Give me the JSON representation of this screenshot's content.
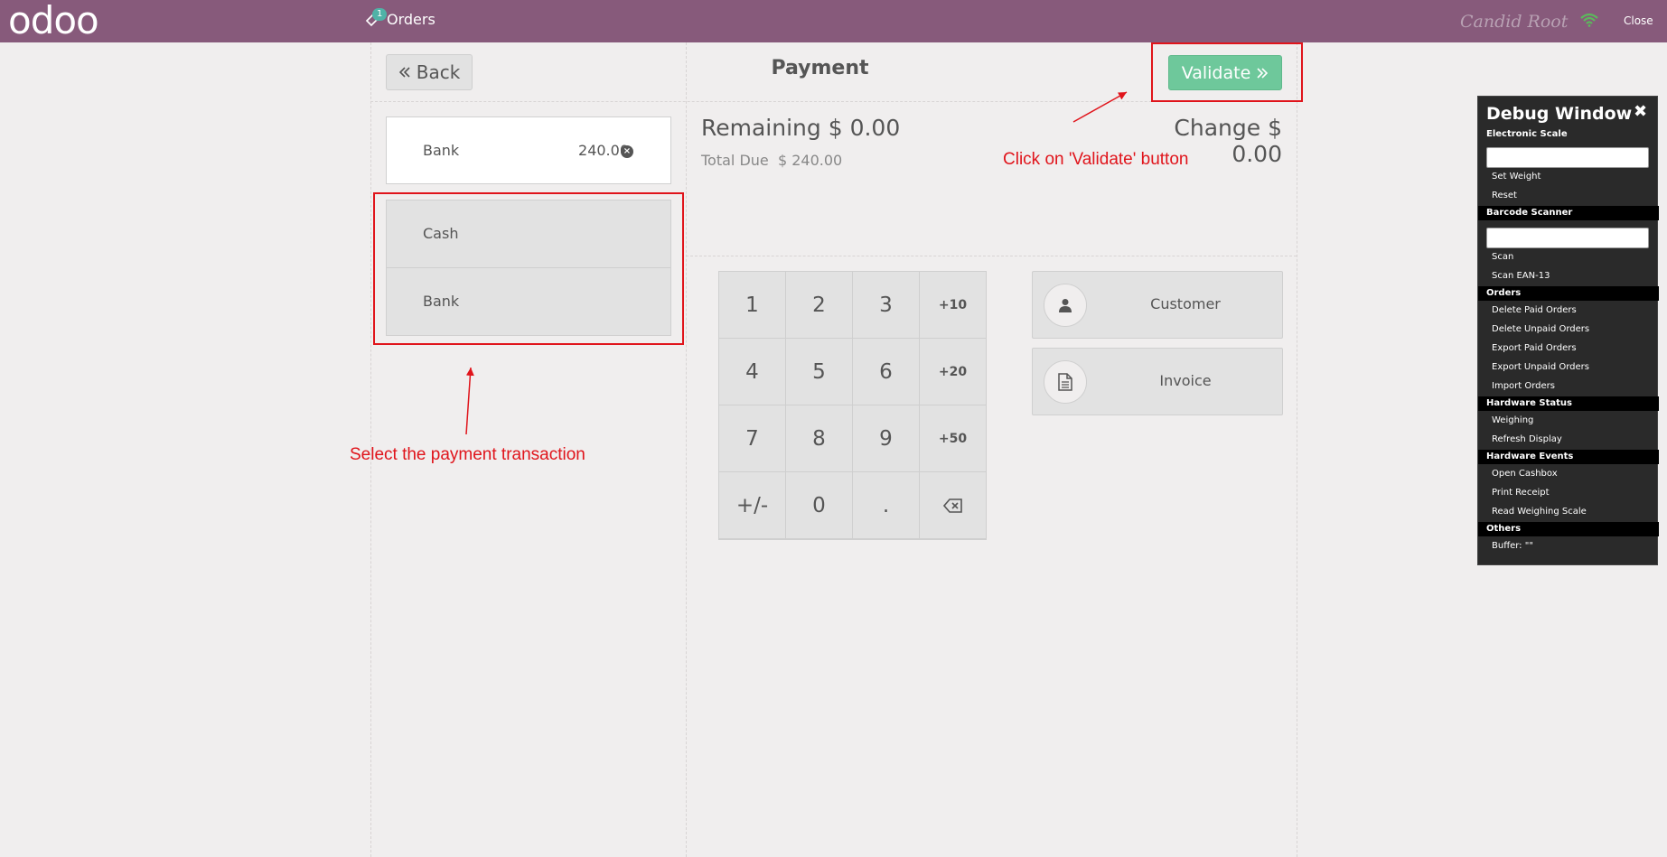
{
  "topbar": {
    "logo": "odoo",
    "orders_label": "Orders",
    "orders_count": "1",
    "username": "Candid Root",
    "close_label": "Close"
  },
  "payment": {
    "back_label": "Back",
    "title": "Payment",
    "validate_label": "Validate",
    "paymentline": {
      "name": "Bank",
      "amount": "240.00"
    },
    "methods": [
      "Cash",
      "Bank"
    ],
    "remaining_label": "Remaining",
    "remaining_value": "$ 0.00",
    "change_label": "Change",
    "change_value": "$ 0.00",
    "total_due_label": "Total Due",
    "total_due_value": "$ 240.00"
  },
  "numpad": {
    "keys": [
      "1",
      "2",
      "3",
      "+10",
      "4",
      "5",
      "6",
      "+20",
      "7",
      "8",
      "9",
      "+50",
      "+/-",
      "0",
      ".",
      "backspace"
    ]
  },
  "side_buttons": {
    "customer": "Customer",
    "invoice": "Invoice"
  },
  "annotations": {
    "validate_note": "Click on 'Validate' button",
    "select_note": "Select the payment transaction"
  },
  "debug": {
    "title": "Debug Window",
    "sections": {
      "scale": "Electronic Scale",
      "barcode": "Barcode Scanner",
      "orders": "Orders",
      "hw_status": "Hardware Status",
      "hw_events": "Hardware Events",
      "others": "Others"
    },
    "items": {
      "set_weight": "Set Weight",
      "reset": "Reset",
      "scan": "Scan",
      "scan_ean": "Scan EAN-13",
      "delete_paid": "Delete Paid Orders",
      "delete_unpaid": "Delete Unpaid Orders",
      "export_paid": "Export Paid Orders",
      "export_unpaid": "Export Unpaid Orders",
      "import_orders": "Import Orders",
      "weighing": "Weighing",
      "refresh_display": "Refresh Display",
      "open_cashbox": "Open Cashbox",
      "print_receipt": "Print Receipt",
      "read_scale": "Read Weighing Scale",
      "buffer": "Buffer: \"\""
    }
  },
  "colors": {
    "topbar": "#875a7b",
    "validate": "#6ec89b",
    "annotation": "#e0141b",
    "badge": "#50b2a7"
  }
}
